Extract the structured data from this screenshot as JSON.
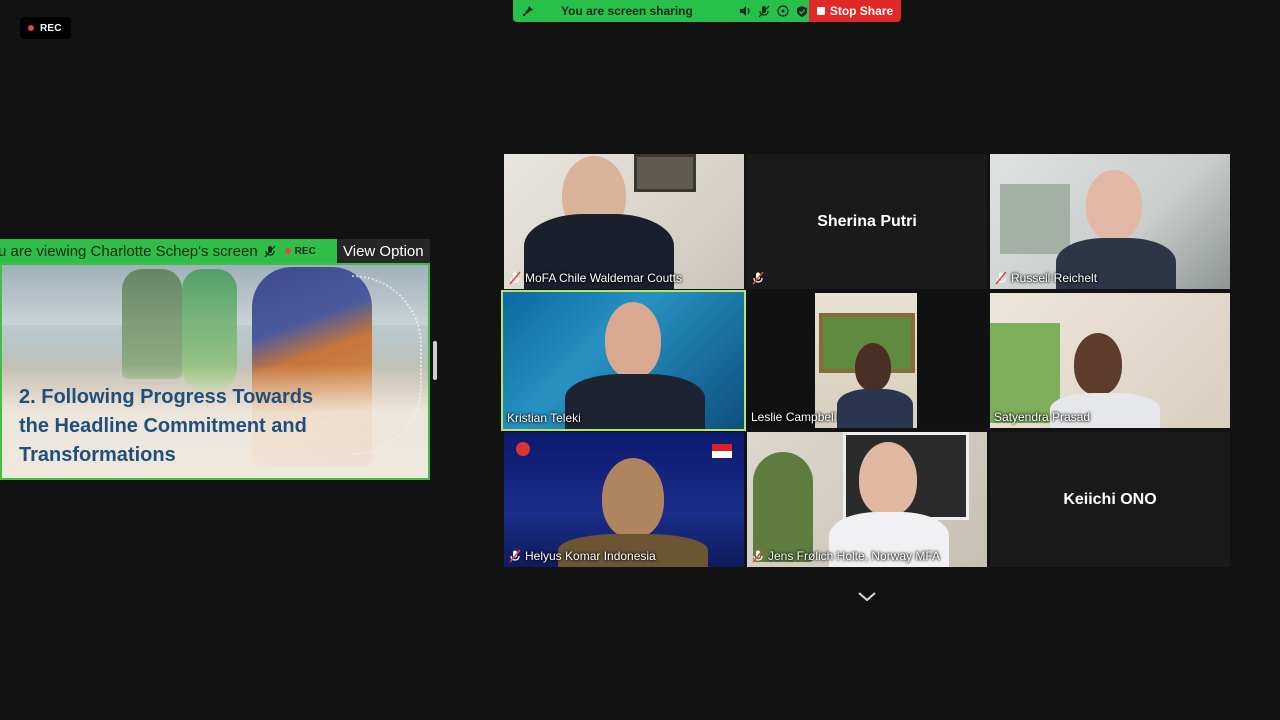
{
  "rec_badge": {
    "label": "REC"
  },
  "share_bar": {
    "status_text": "You are screen sharing",
    "stop_label": "Stop Share"
  },
  "viewing_banner": {
    "text": "u are viewing Charlotte Schep's screen",
    "rec_label": "REC",
    "view_options_label": "View Option"
  },
  "shared_screen": {
    "slide_title": "2. Following Progress Towards the Headline Commitment and Transformations"
  },
  "participants": [
    {
      "name": "MoFA Chile Waldemar Coutts",
      "muted": true
    },
    {
      "name": "Sherina Putri",
      "muted": true,
      "video": false
    },
    {
      "name": "Russell Reichelt",
      "muted": true
    },
    {
      "name": "Kristian Teleki",
      "muted": false,
      "active_speaker": true
    },
    {
      "name": "Leslie Campbell",
      "muted": false
    },
    {
      "name": "Satyendra Prasad",
      "muted": false
    },
    {
      "name": "Helyus Komar Indonesia",
      "muted": true
    },
    {
      "name": "Jens Frølich Holte, Norway MFA",
      "muted": true
    },
    {
      "name": "Keiichi ONO",
      "muted": false,
      "video": false
    }
  ],
  "colors": {
    "share_green": "#26c04a",
    "stop_red": "#e02828",
    "active_border": "#b8e36c",
    "slide_title": "#1f4f7c",
    "mute_red": "#e8453c"
  }
}
